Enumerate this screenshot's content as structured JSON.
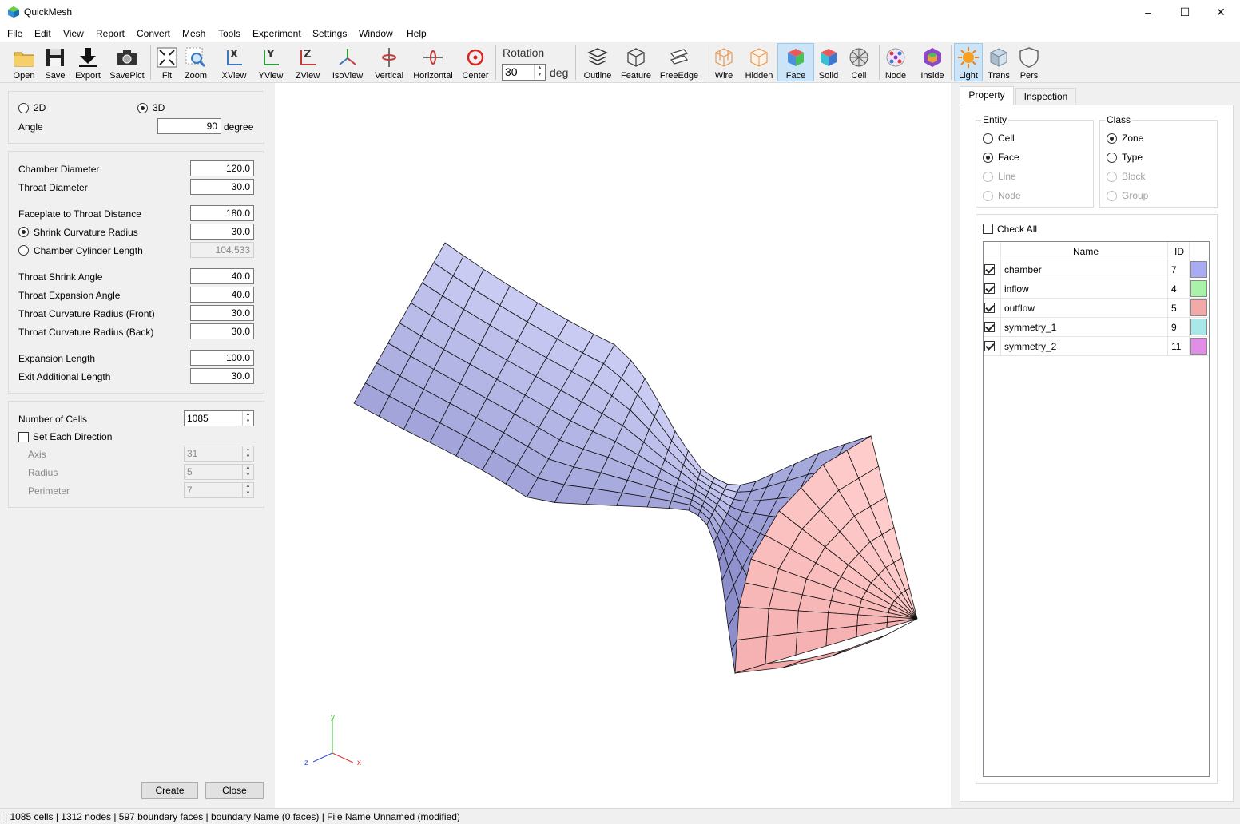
{
  "app": {
    "title": "QuickMesh"
  },
  "window_controls": {
    "minimize": "–",
    "maximize": "☐",
    "close": "✕"
  },
  "menu": [
    "File",
    "Edit",
    "View",
    "Report",
    "Convert",
    "Mesh",
    "Tools",
    "Experiment",
    "Settings",
    "Window",
    "Help"
  ],
  "toolbar": {
    "open": "Open",
    "save": "Save",
    "export": "Export",
    "savepict": "SavePict",
    "fit": "Fit",
    "zoom": "Zoom",
    "xview": "XView",
    "yview": "YView",
    "zview": "ZView",
    "isoview": "IsoView",
    "vertical": "Vertical",
    "horizontal": "Horizontal",
    "center": "Center",
    "rotation_label": "Rotation",
    "rotation_value": "30",
    "rotation_unit": "deg",
    "outline": "Outline",
    "feature": "Feature",
    "freeedge": "FreeEdge",
    "wire": "Wire",
    "hidden": "Hidden",
    "face": "Face",
    "solid": "Solid",
    "cell": "Cell",
    "node": "Node",
    "inside": "Inside",
    "light": "Light",
    "trans": "Trans",
    "pers": "Pers"
  },
  "left_panel": {
    "dim_2d": "2D",
    "dim_3d": "3D",
    "angle_label": "Angle",
    "angle_value": "90",
    "angle_unit": "degree",
    "chamber_diameter_label": "Chamber Diameter",
    "chamber_diameter": "120.0",
    "throat_diameter_label": "Throat Diameter",
    "throat_diameter": "30.0",
    "faceplate_label": "Faceplate to Throat Distance",
    "faceplate": "180.0",
    "shrink_radius_label": "Shrink Curvature Radius",
    "shrink_radius": "30.0",
    "cyl_length_label": "Chamber Cylinder Length",
    "cyl_length": "104.533",
    "shrink_angle_label": "Throat Shrink Angle",
    "shrink_angle": "40.0",
    "exp_angle_label": "Throat Expansion Angle",
    "exp_angle": "40.0",
    "curv_front_label": "Throat Curvature Radius (Front)",
    "curv_front": "30.0",
    "curv_back_label": "Throat Curvature Radius (Back)",
    "curv_back": "30.0",
    "exp_length_label": "Expansion Length",
    "exp_length": "100.0",
    "exit_length_label": "Exit Additional Length",
    "exit_length": "30.0",
    "cells_label": "Number of Cells",
    "cells": "1085",
    "each_dir_label": "Set Each Direction",
    "axis_label": "Axis",
    "axis": "31",
    "radius_label": "Radius",
    "radius": "5",
    "perimeter_label": "Perimeter",
    "perimeter": "7",
    "create": "Create",
    "close": "Close"
  },
  "viewport": {
    "axis_x": "x",
    "axis_y": "y",
    "axis_z": "z"
  },
  "right_panel": {
    "tab_property": "Property",
    "tab_inspection": "Inspection",
    "entity_title": "Entity",
    "entity": [
      "Cell",
      "Face",
      "Line",
      "Node"
    ],
    "class_title": "Class",
    "class": [
      "Zone",
      "Type",
      "Block",
      "Group"
    ],
    "check_all": "Check All",
    "col_name": "Name",
    "col_id": "ID",
    "rows": [
      {
        "name": "chamber",
        "id": "7",
        "color": "#a9acf2"
      },
      {
        "name": "inflow",
        "id": "4",
        "color": "#a9f2a9"
      },
      {
        "name": "outflow",
        "id": "5",
        "color": "#f2a9a9"
      },
      {
        "name": "symmetry_1",
        "id": "9",
        "color": "#a9e8e8"
      },
      {
        "name": "symmetry_2",
        "id": "11",
        "color": "#e08ee8"
      }
    ]
  },
  "status": "| 1085 cells | 1312 nodes | 597 boundary faces |  boundary Name  (0 faces) | File Name Unnamed (modified)"
}
